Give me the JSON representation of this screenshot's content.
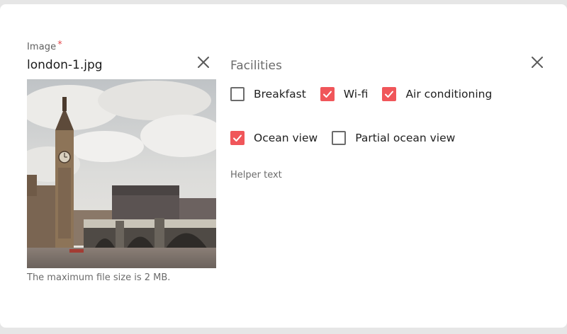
{
  "image_field": {
    "label": "Image",
    "required_mark": "*",
    "filename": "london-1.jpg",
    "hint": "The maximum file size is 2 MB."
  },
  "facilities": {
    "label": "Facilities",
    "options": [
      {
        "label": "Breakfast",
        "checked": false
      },
      {
        "label": "Wi-fi",
        "checked": true
      },
      {
        "label": "Air conditioning",
        "checked": true
      },
      {
        "label": "Ocean view",
        "checked": true
      },
      {
        "label": "Partial ocean view",
        "checked": false
      }
    ],
    "helper_text": "Helper text"
  },
  "colors": {
    "accent": "#f0565a",
    "text": "#1f1f1f",
    "muted": "#6b6b6b"
  }
}
